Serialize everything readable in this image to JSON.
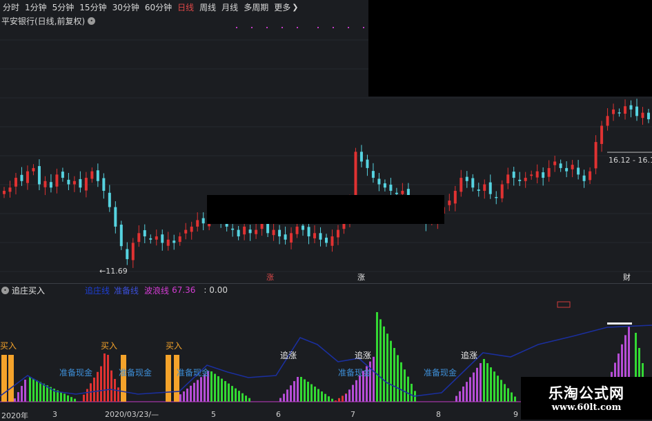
{
  "toolbar": {
    "items": [
      "分时",
      "1分钟",
      "5分钟",
      "15分钟",
      "30分钟",
      "60分钟",
      "日线",
      "周线",
      "月线",
      "多周期",
      "更多"
    ],
    "active": "日线"
  },
  "title": "平安银行(日线,前复权)",
  "price_labels": {
    "low": "←11.69",
    "high": "16.12 - 16.1"
  },
  "markers": {
    "m1": "涨",
    "m2": "涨",
    "m3": "财"
  },
  "indicator": {
    "name": "追庄买入",
    "line1_label": "追庄线",
    "line2_label": "准备线",
    "line3_label": "波浪线",
    "line3_value": "67.36",
    "value4": ": 0.00"
  },
  "annotations": {
    "buy": "买入",
    "chase": "追涨",
    "prepare": "准备现金"
  },
  "x_axis": [
    "2020年",
    "3",
    "2020/03/23/—",
    "5",
    "6",
    "7",
    "8",
    "9"
  ],
  "logo": {
    "cn": "乐淘公式网",
    "url": "www.60lt.com"
  },
  "colors": {
    "up": "#e03232",
    "down": "#56d3e0",
    "bg": "#1b1d21",
    "green": "#33d933",
    "magenta": "#b64dd6",
    "orange": "#f4a32b",
    "blue_line": "#1b2f9e",
    "label_blue": "#3e8fd8"
  },
  "chart_data": [
    {
      "type": "candlestick",
      "title": "平安银行(日线,前复权)",
      "x_labels": [
        "2020年",
        "3",
        "2020/03/23",
        "5",
        "6",
        "7",
        "8",
        "9"
      ],
      "annotated_low": 11.69,
      "annotated_high": 16.12,
      "series": [
        {
          "name": "close",
          "values": [
            13.9,
            14.0,
            14.3,
            14.2,
            14.5,
            14.6,
            14.1,
            14.2,
            14.0,
            14.4,
            14.3,
            14.1,
            14.2,
            14.0,
            14.3,
            14.5,
            14.2,
            13.9,
            13.4,
            12.8,
            12.2,
            11.8,
            12.3,
            12.6,
            12.5,
            12.4,
            12.5,
            12.3,
            12.4,
            12.3,
            12.5,
            12.7,
            12.8,
            13.0,
            12.9,
            13.1,
            13.2,
            13.0,
            12.8,
            12.7,
            12.5,
            12.8,
            12.6,
            12.7,
            12.9,
            12.6,
            12.7,
            12.5,
            12.4,
            12.6,
            12.8,
            12.7,
            12.5,
            12.6,
            12.4,
            12.3,
            12.5,
            12.7,
            12.9,
            13.6,
            15.1,
            14.8,
            14.6,
            14.3,
            14.1,
            14.0,
            13.9,
            13.8,
            13.9,
            13.6,
            13.3,
            13.1,
            12.9,
            13.0,
            13.2,
            13.4,
            13.6,
            13.9,
            14.3,
            14.2,
            14.0,
            13.9,
            14.1,
            13.8,
            13.7,
            14.1,
            14.4,
            14.3,
            14.2,
            14.3,
            14.4,
            14.5,
            14.3,
            14.6,
            14.8,
            14.6,
            14.5,
            14.7,
            14.4,
            14.2,
            14.5,
            15.4,
            15.9,
            16.2,
            16.4,
            16.3,
            16.5,
            16.4,
            16.2,
            16.3,
            16.1
          ]
        }
      ]
    },
    {
      "type": "bar",
      "title": "追庄买入",
      "series": [
        {
          "name": "追庄线",
          "values": []
        },
        {
          "name": "波浪线",
          "values": [
            67.36
          ]
        }
      ]
    }
  ]
}
